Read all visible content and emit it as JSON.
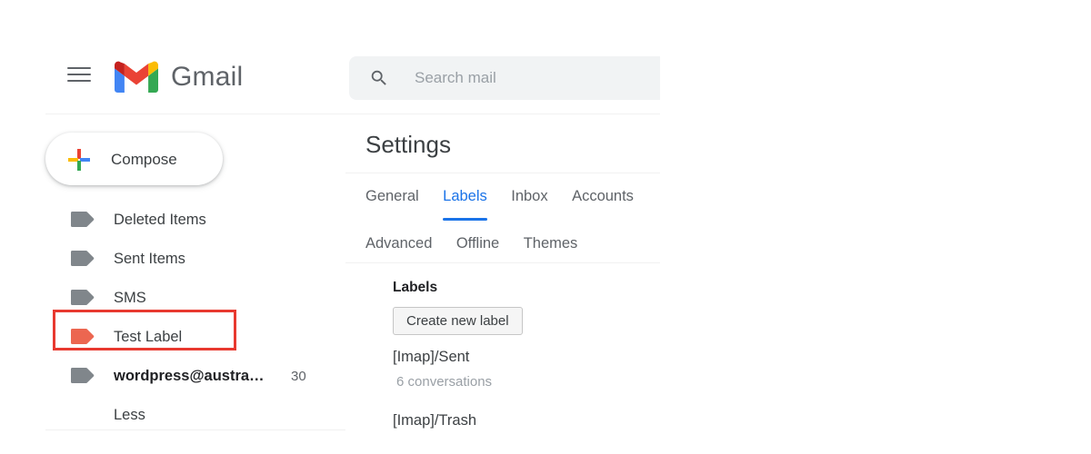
{
  "header": {
    "menu_icon": "hamburger-menu-icon",
    "logo_icon": "gmail-logo-icon",
    "wordmark": "Gmail"
  },
  "search": {
    "icon": "search-icon",
    "placeholder": "Search mail",
    "value": ""
  },
  "sidebar": {
    "compose": {
      "label": "Compose",
      "icon": "plus-icon"
    },
    "items": [
      {
        "label": "Deleted Items",
        "icon": "label-tag-icon",
        "color": "#80868b",
        "count": "",
        "bold": false,
        "highlighted": false
      },
      {
        "label": "Sent Items",
        "icon": "label-tag-icon",
        "color": "#80868b",
        "count": "",
        "bold": false,
        "highlighted": false
      },
      {
        "label": "SMS",
        "icon": "label-tag-icon",
        "color": "#80868b",
        "count": "",
        "bold": false,
        "highlighted": false
      },
      {
        "label": "Test Label",
        "icon": "label-tag-icon",
        "color": "#ec6650",
        "count": "",
        "bold": false,
        "highlighted": true
      },
      {
        "label": "wordpress@austra…",
        "icon": "label-tag-icon",
        "color": "#80868b",
        "count": "30",
        "bold": true,
        "highlighted": false
      }
    ],
    "less_label": "Less"
  },
  "settings": {
    "title": "Settings",
    "tabs_row1": [
      {
        "label": "General",
        "active": false
      },
      {
        "label": "Labels",
        "active": true
      },
      {
        "label": "Inbox",
        "active": false
      },
      {
        "label": "Accounts",
        "active": false
      }
    ],
    "tabs_row2": [
      {
        "label": "Advanced",
        "active": false
      },
      {
        "label": "Offline",
        "active": false
      },
      {
        "label": "Themes",
        "active": false
      }
    ],
    "labels_section": {
      "heading": "Labels",
      "create_button": "Create new label",
      "rows": [
        {
          "name": "[Imap]/Sent",
          "sub": "6 conversations"
        },
        {
          "name": "[Imap]/Trash",
          "sub": ""
        }
      ]
    }
  },
  "colors": {
    "accent_blue": "#1a73e8",
    "highlight_red": "#e8392f",
    "test_label_orange": "#ec6650",
    "tag_gray": "#80868b",
    "text_primary": "#3c4043",
    "text_secondary": "#5f6368",
    "text_muted": "#9aa0a6",
    "search_bg": "#f1f3f4"
  }
}
